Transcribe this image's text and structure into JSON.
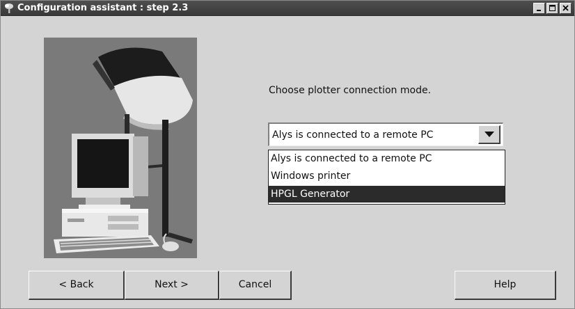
{
  "window": {
    "title": "Configuration assistant : step 2.3",
    "icon": "tree-icon"
  },
  "main": {
    "prompt": "Choose plotter connection mode.",
    "connection_mode": {
      "selected_value": "Alys is connected to a remote PC",
      "options": [
        "Alys is connected to a remote PC",
        "Windows printer",
        "HPGL Generator"
      ],
      "highlighted_option": "HPGL Generator"
    }
  },
  "buttons": {
    "back": "< Back",
    "next": "Next >",
    "cancel": "Cancel",
    "help": "Help"
  }
}
